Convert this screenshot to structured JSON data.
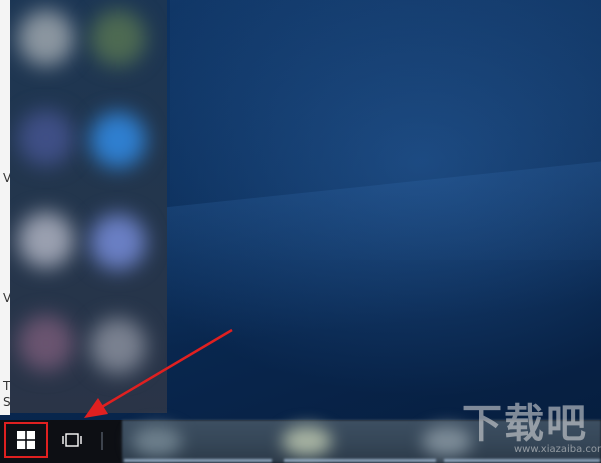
{
  "left_edge": {
    "letters": [
      "V",
      "V",
      "T",
      "S"
    ]
  },
  "taskbar": {
    "start_icon": "windows-logo-icon",
    "task_view_icon": "task-view-icon"
  },
  "annotation": {
    "highlight_color": "#e02020",
    "arrow_color": "#e02020"
  },
  "watermark": {
    "text": "下载吧",
    "url": "www.xiazaiba.com"
  }
}
